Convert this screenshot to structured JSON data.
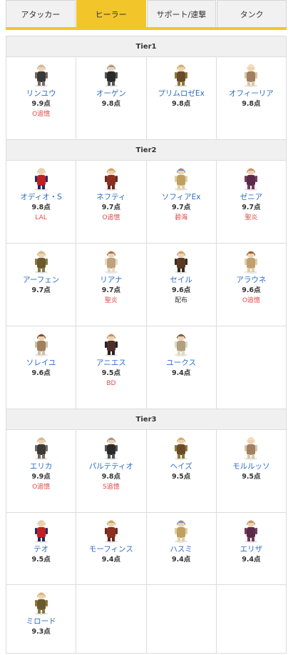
{
  "tabs": [
    {
      "label": "アタッカー",
      "active": false
    },
    {
      "label": "ヒーラー",
      "active": true
    },
    {
      "label": "サポート/速撃",
      "active": false
    },
    {
      "label": "タンク",
      "active": false
    }
  ],
  "colors": {
    "accent": "#f2c52a",
    "link": "#2b6cc4",
    "tag_red": "#e04848"
  },
  "tiers": [
    {
      "title": "Tier1",
      "rows": [
        [
          {
            "name": "リンユウ",
            "score": "9.9点",
            "tag": "O追憶"
          },
          {
            "name": "オーゲン",
            "score": "9.8点",
            "tag": ""
          },
          {
            "name": "プリムロゼEx",
            "score": "9.8点",
            "tag": ""
          },
          {
            "name": "オフィーリア",
            "score": "9.8点",
            "tag": ""
          }
        ]
      ]
    },
    {
      "title": "Tier2",
      "rows": [
        [
          {
            "name": "オディオ・S",
            "score": "9.8点",
            "tag": "LAL"
          },
          {
            "name": "ネフティ",
            "score": "9.7点",
            "tag": "O追憶"
          },
          {
            "name": "ソフィアEx",
            "score": "9.7点",
            "tag": "碧海"
          },
          {
            "name": "ゼニア",
            "score": "9.7点",
            "tag": "聖炎"
          }
        ],
        [
          {
            "name": "アーフェン",
            "score": "9.7点",
            "tag": ""
          },
          {
            "name": "リアナ",
            "score": "9.7点",
            "tag": "聖炎"
          },
          {
            "name": "セイル",
            "score": "9.6点",
            "tag": "配布"
          },
          {
            "name": "アラウネ",
            "score": "9.6点",
            "tag": "O追憶"
          }
        ],
        [
          {
            "name": "ソレイユ",
            "score": "9.6点",
            "tag": ""
          },
          {
            "name": "アニエス",
            "score": "9.5点",
            "tag": "BD"
          },
          {
            "name": "ユークス",
            "score": "9.4点",
            "tag": ""
          }
        ]
      ]
    },
    {
      "title": "Tier3",
      "rows": [
        [
          {
            "name": "エリカ",
            "score": "9.9点",
            "tag": "O追憶"
          },
          {
            "name": "パルテティオ",
            "score": "9.8点",
            "tag": "S追憶"
          },
          {
            "name": "ヘイズ",
            "score": "9.5点",
            "tag": ""
          },
          {
            "name": "モルルッソ",
            "score": "9.5点",
            "tag": ""
          }
        ],
        [
          {
            "name": "テオ",
            "score": "9.5点",
            "tag": ""
          },
          {
            "name": "モーフィンス",
            "score": "9.4点",
            "tag": ""
          },
          {
            "name": "ハスミ",
            "score": "9.4点",
            "tag": ""
          },
          {
            "name": "エリザ",
            "score": "9.4点",
            "tag": ""
          }
        ],
        [
          {
            "name": "ミロード",
            "score": "9.3点",
            "tag": ""
          }
        ]
      ]
    }
  ]
}
